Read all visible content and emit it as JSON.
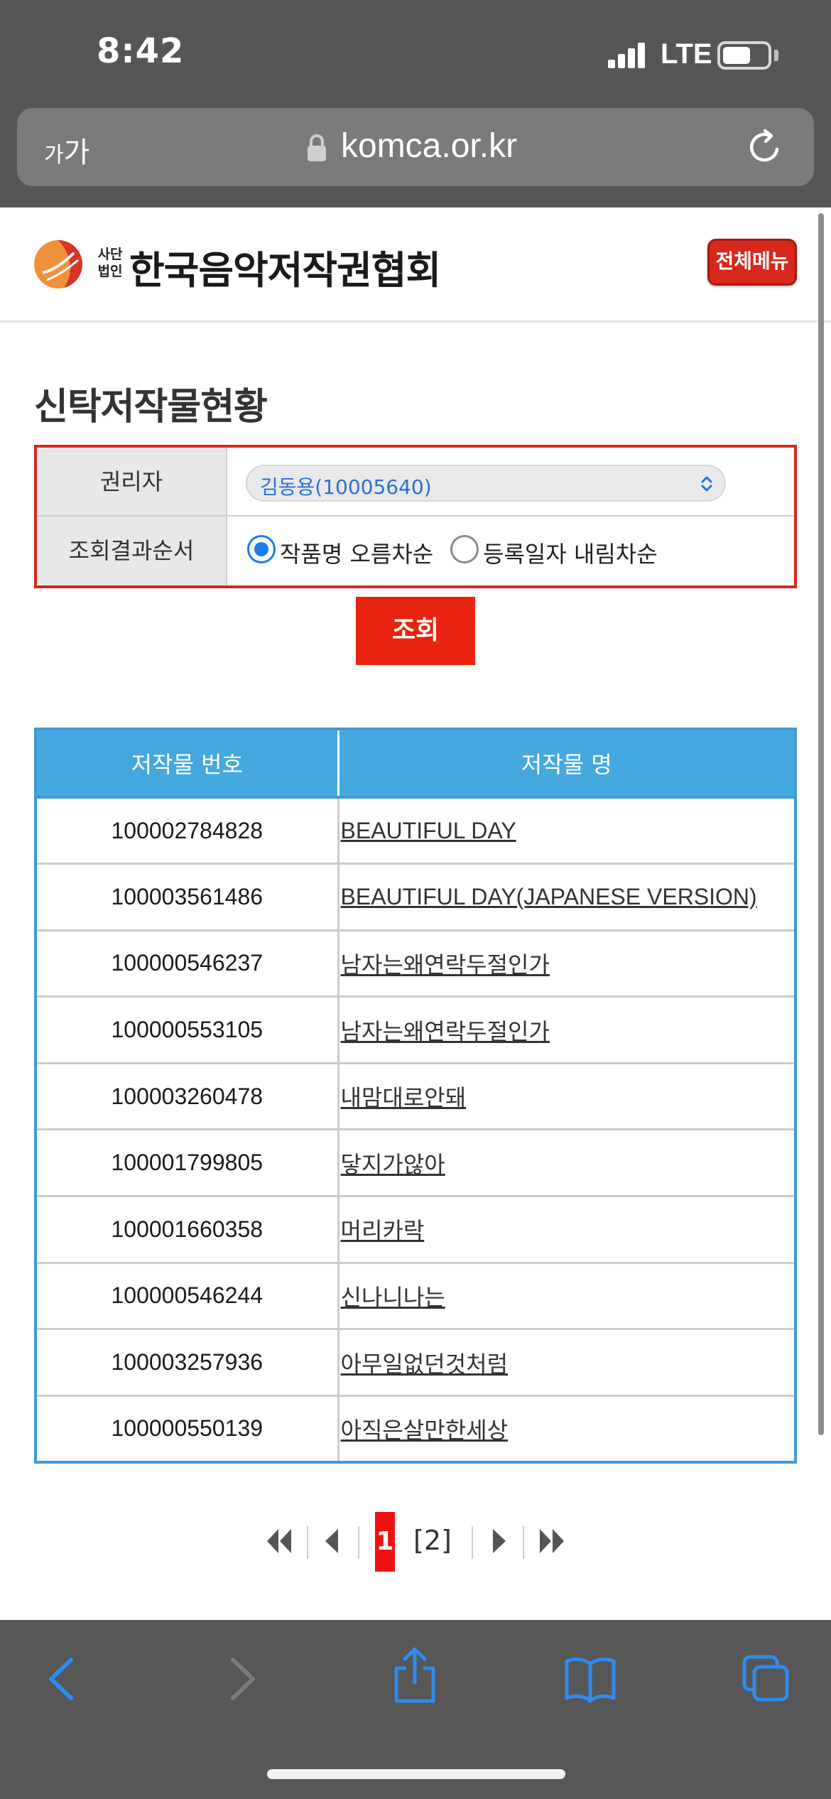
{
  "status_bar": {
    "time": "8:42",
    "network": "LTE"
  },
  "browser": {
    "text_size_label_small": "가",
    "text_size_label_large": "가",
    "url": "komca.or.kr"
  },
  "site": {
    "logo_sub_line1": "사단",
    "logo_sub_line2": "법인",
    "logo_name": "한국음악저작권협회",
    "menu_button": "전체메뉴"
  },
  "page": {
    "title": "신탁저작물현황",
    "search": {
      "holder_label": "권리자",
      "holder_value": "김동용(10005640)",
      "order_label": "조회결과순서",
      "order_options": [
        "작품명 오름차순",
        "등록일자 내림차순"
      ],
      "order_selected": "작품명 오름차순",
      "submit_label": "조회"
    },
    "table": {
      "headers": [
        "저작물 번호",
        "저작물 명"
      ],
      "rows": [
        {
          "number": "100002784828",
          "title": "BEAUTIFUL DAY"
        },
        {
          "number": "100003561486",
          "title": "BEAUTIFUL DAY(JAPANESE VERSION)"
        },
        {
          "number": "100000546237",
          "title": "남자는왜연락두절인가"
        },
        {
          "number": "100000553105",
          "title": "남자는왜연락두절인가"
        },
        {
          "number": "100003260478",
          "title": "내맘대로안돼"
        },
        {
          "number": "100001799805",
          "title": "닿지가않아"
        },
        {
          "number": "100001660358",
          "title": "머리카락"
        },
        {
          "number": "100000546244",
          "title": "신나니나는"
        },
        {
          "number": "100003257936",
          "title": "아무일없던것처럼"
        },
        {
          "number": "100000550139",
          "title": "아직은살만한세상"
        }
      ]
    },
    "pagination": {
      "current": "1",
      "other": "[2]"
    }
  },
  "colors": {
    "accent_red": "#d6281c",
    "table_blue": "#45a8de",
    "radio_blue": "#1b7cf0"
  }
}
